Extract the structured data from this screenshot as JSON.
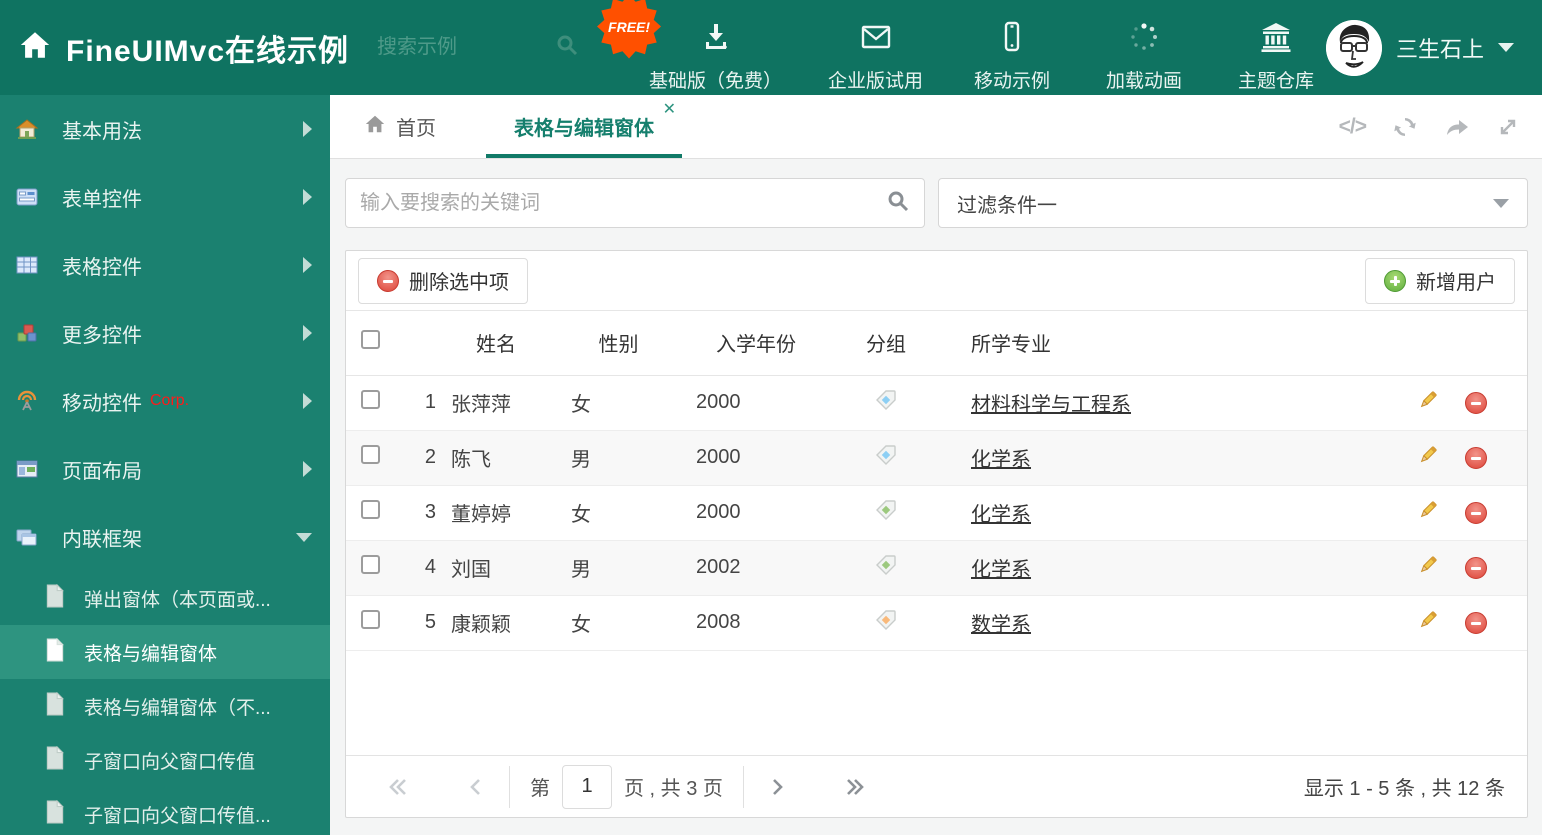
{
  "header": {
    "title": "FineUIMvc在线示例",
    "search_placeholder": "搜索示例",
    "free_badge": "FREE!",
    "nav": [
      {
        "label": "基础版（免费）",
        "icon": "download-icon"
      },
      {
        "label": "企业版试用",
        "icon": "envelope-icon"
      },
      {
        "label": "移动示例",
        "icon": "mobile-icon"
      },
      {
        "label": "加载动画",
        "icon": "spinner-icon"
      },
      {
        "label": "主题仓库",
        "icon": "bank-icon"
      }
    ],
    "user": {
      "name": "三生石上"
    }
  },
  "sidebar": {
    "items": [
      {
        "label": "基本用法",
        "icon": "home-icon"
      },
      {
        "label": "表单控件",
        "icon": "form-icon"
      },
      {
        "label": "表格控件",
        "icon": "table-icon"
      },
      {
        "label": "更多控件",
        "icon": "cubes-icon"
      },
      {
        "label": "移动控件",
        "badge": "Corp.",
        "icon": "antenna-icon"
      },
      {
        "label": "页面布局",
        "icon": "layout-icon"
      },
      {
        "label": "内联框架",
        "icon": "frames-icon",
        "expanded": true
      }
    ],
    "subitems": [
      {
        "label": "弹出窗体（本页面或..."
      },
      {
        "label": "表格与编辑窗体",
        "active": true
      },
      {
        "label": "表格与编辑窗体（不..."
      },
      {
        "label": "子窗口向父窗口传值"
      },
      {
        "label": "子窗口向父窗口传值..."
      }
    ]
  },
  "tabbar": {
    "tabs": [
      {
        "label": "首页"
      },
      {
        "label": "表格与编辑窗体",
        "active": true,
        "closable": true
      }
    ]
  },
  "filter": {
    "search_placeholder": "输入要搜索的关键词",
    "dropdown_value": "过滤条件一"
  },
  "toolbar": {
    "delete_label": "删除选中项",
    "add_label": "新增用户"
  },
  "grid": {
    "columns": {
      "name": "姓名",
      "gender": "性别",
      "year": "入学年份",
      "group": "分组",
      "major": "所学专业"
    },
    "rows": [
      {
        "num": "1",
        "name": "张萍萍",
        "gender": "女",
        "year": "2000",
        "tag_color": "#8DCFF4",
        "major": "材料科学与工程系"
      },
      {
        "num": "2",
        "name": "陈飞",
        "gender": "男",
        "year": "2000",
        "tag_color": "#8DCFF4",
        "major": "化学系"
      },
      {
        "num": "3",
        "name": "董婷婷",
        "gender": "女",
        "year": "2000",
        "tag_color": "#9CC97E",
        "major": "化学系"
      },
      {
        "num": "4",
        "name": "刘国",
        "gender": "男",
        "year": "2002",
        "tag_color": "#9CC97E",
        "major": "化学系"
      },
      {
        "num": "5",
        "name": "康颖颖",
        "gender": "女",
        "year": "2008",
        "tag_color": "#F9B97A",
        "major": "数学系"
      }
    ]
  },
  "pagination": {
    "prefix": "第",
    "current": "1",
    "suffix": "页 , 共 3 页",
    "summary": "显示 1 - 5 条 , 共 12 条"
  },
  "colors": {
    "header_bg": "#0F7361",
    "sidebar_bg": "#1B8170",
    "sidebar_active_bg": "#2E9480",
    "accent_teal": "#157F6D",
    "free_badge_orange": "#FF5000",
    "corp_red": "#FF1A1A",
    "delete_red": "#DD4438",
    "add_green": "#5FAE3E",
    "tag_blue": "#8DCFF4",
    "tag_green": "#9CC97E",
    "tag_orange": "#F9B97A"
  }
}
